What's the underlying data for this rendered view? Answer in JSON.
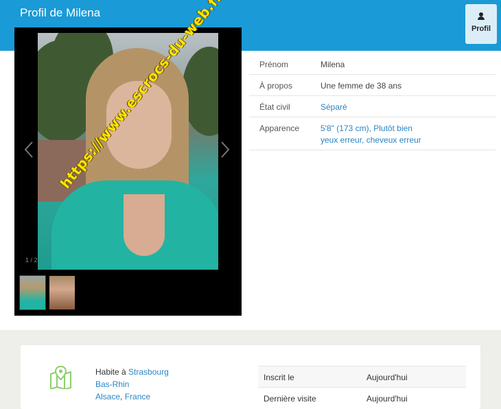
{
  "header": {
    "title": "Profil de Milena",
    "profile_tab_label": "Profil",
    "profile_tab_icon": "user-icon",
    "color": "#1a9ad6"
  },
  "gallery": {
    "watermark": "https://www.escrocs-du-web.fr",
    "counter": "1 / 2",
    "prev_icon": "chevron-left-icon",
    "next_icon": "chevron-right-icon",
    "thumbnail_count": 2
  },
  "details": [
    {
      "label": "Prénom",
      "value": "Milena"
    },
    {
      "label": "À propos",
      "value": "Une femme de 38 ans"
    },
    {
      "label": "État civil",
      "value": "Séparé"
    },
    {
      "label": "Apparence",
      "value_line1": "5'8\" (173 cm), Plutôt bien",
      "value_line2": "yeux erreur, cheveux erreur"
    }
  ],
  "location": {
    "icon": "map-icon",
    "prefix": "Habite à",
    "city": "Strasbourg",
    "region": "Bas-Rhin",
    "area": "Alsace",
    "separator": ",",
    "country": "France"
  },
  "stats": [
    {
      "label": "Inscrit le",
      "value": "Aujourd'hui"
    },
    {
      "label": "Dernière visite",
      "value": "Aujourd'hui"
    }
  ],
  "colors": {
    "link": "#2a85c6",
    "watermark": "#ffe600"
  }
}
